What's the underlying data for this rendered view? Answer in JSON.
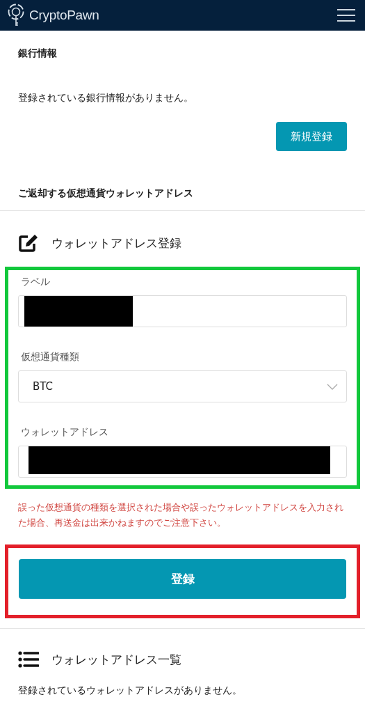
{
  "header": {
    "logo": "CryptoPawn"
  },
  "bank": {
    "title": "銀行情報",
    "message": "登録されている銀行情報がありません。",
    "button": "新規登録"
  },
  "wallet_section": {
    "title": "ご返却する仮想通貨ウォレットアドレス"
  },
  "register": {
    "title": "ウォレットアドレス登録",
    "fields": [
      {
        "kind": "text",
        "label": "ラベル",
        "redacted": true
      },
      {
        "kind": "select",
        "label": "仮想通貨種類",
        "value": "BTC",
        "redacted": false
      },
      {
        "kind": "text",
        "label": "ウォレットアドレス",
        "redacted": true
      }
    ],
    "warning": "誤った仮想通貨の種類を選択された場合や誤ったウォレットアドレスを入力された場合、再送金は出来かねますのでご注意下さい。",
    "button": "登録"
  },
  "list": {
    "title": "ウォレットアドレス一覧",
    "message": "登録されているウォレットアドレスがありません。"
  }
}
